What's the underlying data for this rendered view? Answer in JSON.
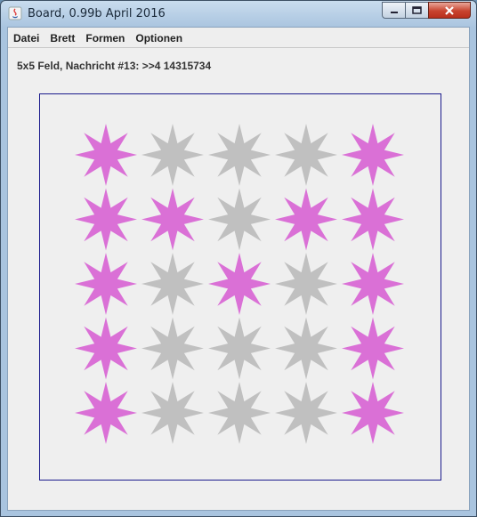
{
  "window": {
    "title": "Board, 0.99b April 2016"
  },
  "menu": [
    {
      "label": "Datei"
    },
    {
      "label": "Brett"
    },
    {
      "label": "Formen"
    },
    {
      "label": "Optionen"
    }
  ],
  "status": {
    "text": "5x5 Feld, Nachricht #13: >>4 14315734"
  },
  "board": {
    "rows": 5,
    "cols": 5,
    "shape": "eight-point-star",
    "colors": {
      "on": "#da70d6",
      "off": "#c0c0c0",
      "border": "#1a1a8c"
    },
    "cells": [
      [
        1,
        0,
        0,
        0,
        1
      ],
      [
        1,
        1,
        0,
        1,
        1
      ],
      [
        1,
        0,
        1,
        0,
        1
      ],
      [
        1,
        0,
        0,
        0,
        1
      ],
      [
        1,
        0,
        0,
        0,
        1
      ]
    ]
  }
}
